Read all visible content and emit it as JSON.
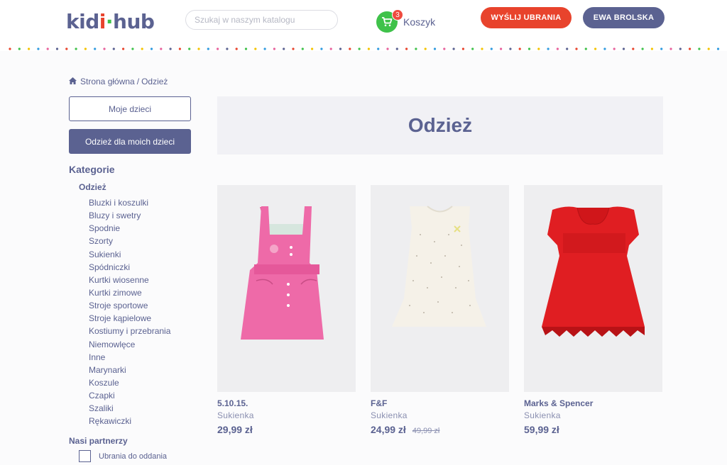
{
  "header": {
    "logo": {
      "k": "kid",
      "dot": "i",
      "rest": "hub",
      "sep": "·"
    },
    "search_placeholder": "Szukaj w naszym katalogu",
    "cart": {
      "label": "Koszyk",
      "count": "3"
    },
    "send_button": "WYŚLIJ UBRANIA",
    "user_button": "EWA BROLSKA"
  },
  "breadcrumb": {
    "home": "Strona główna",
    "separator": "/",
    "current": "Odzież"
  },
  "sidebar": {
    "my_kids_button": "Moje dzieci",
    "clothes_for_kids_button": "Odzież dla moich dzieci",
    "categories_title": "Kategorie",
    "category_parent": "Odzież",
    "categories": [
      "Bluzki i koszulki",
      "Bluzy i swetry",
      "Spodnie",
      "Szorty",
      "Sukienki",
      "Spódniczki",
      "Kurtki wiosenne",
      "Kurtki zimowe",
      "Stroje sportowe",
      "Stroje kąpielowe",
      "Kostiumy i przebrania",
      "Niemowlęce",
      "Inne",
      "Marynarki",
      "Koszule",
      "Czapki",
      "Szaliki",
      "Rękawiczki"
    ],
    "partners_title": "Nasi partnerzy",
    "partner_option": "Ubrania do oddania"
  },
  "main": {
    "title": "Odzież",
    "products": [
      {
        "brand": "5.10.15.",
        "type": "Sukienka",
        "price": "29,99 zł",
        "old_price": ""
      },
      {
        "brand": "F&F",
        "type": "Sukienka",
        "price": "24,99 zł",
        "old_price": "49,99 zł"
      },
      {
        "brand": "Marks & Spencer",
        "type": "Sukienka",
        "price": "59,99 zł",
        "old_price": ""
      }
    ]
  },
  "colors": {
    "primary": "#5b6291",
    "accent": "#e8432c",
    "cart": "#3fc24a",
    "badge": "#ef4b3f"
  }
}
